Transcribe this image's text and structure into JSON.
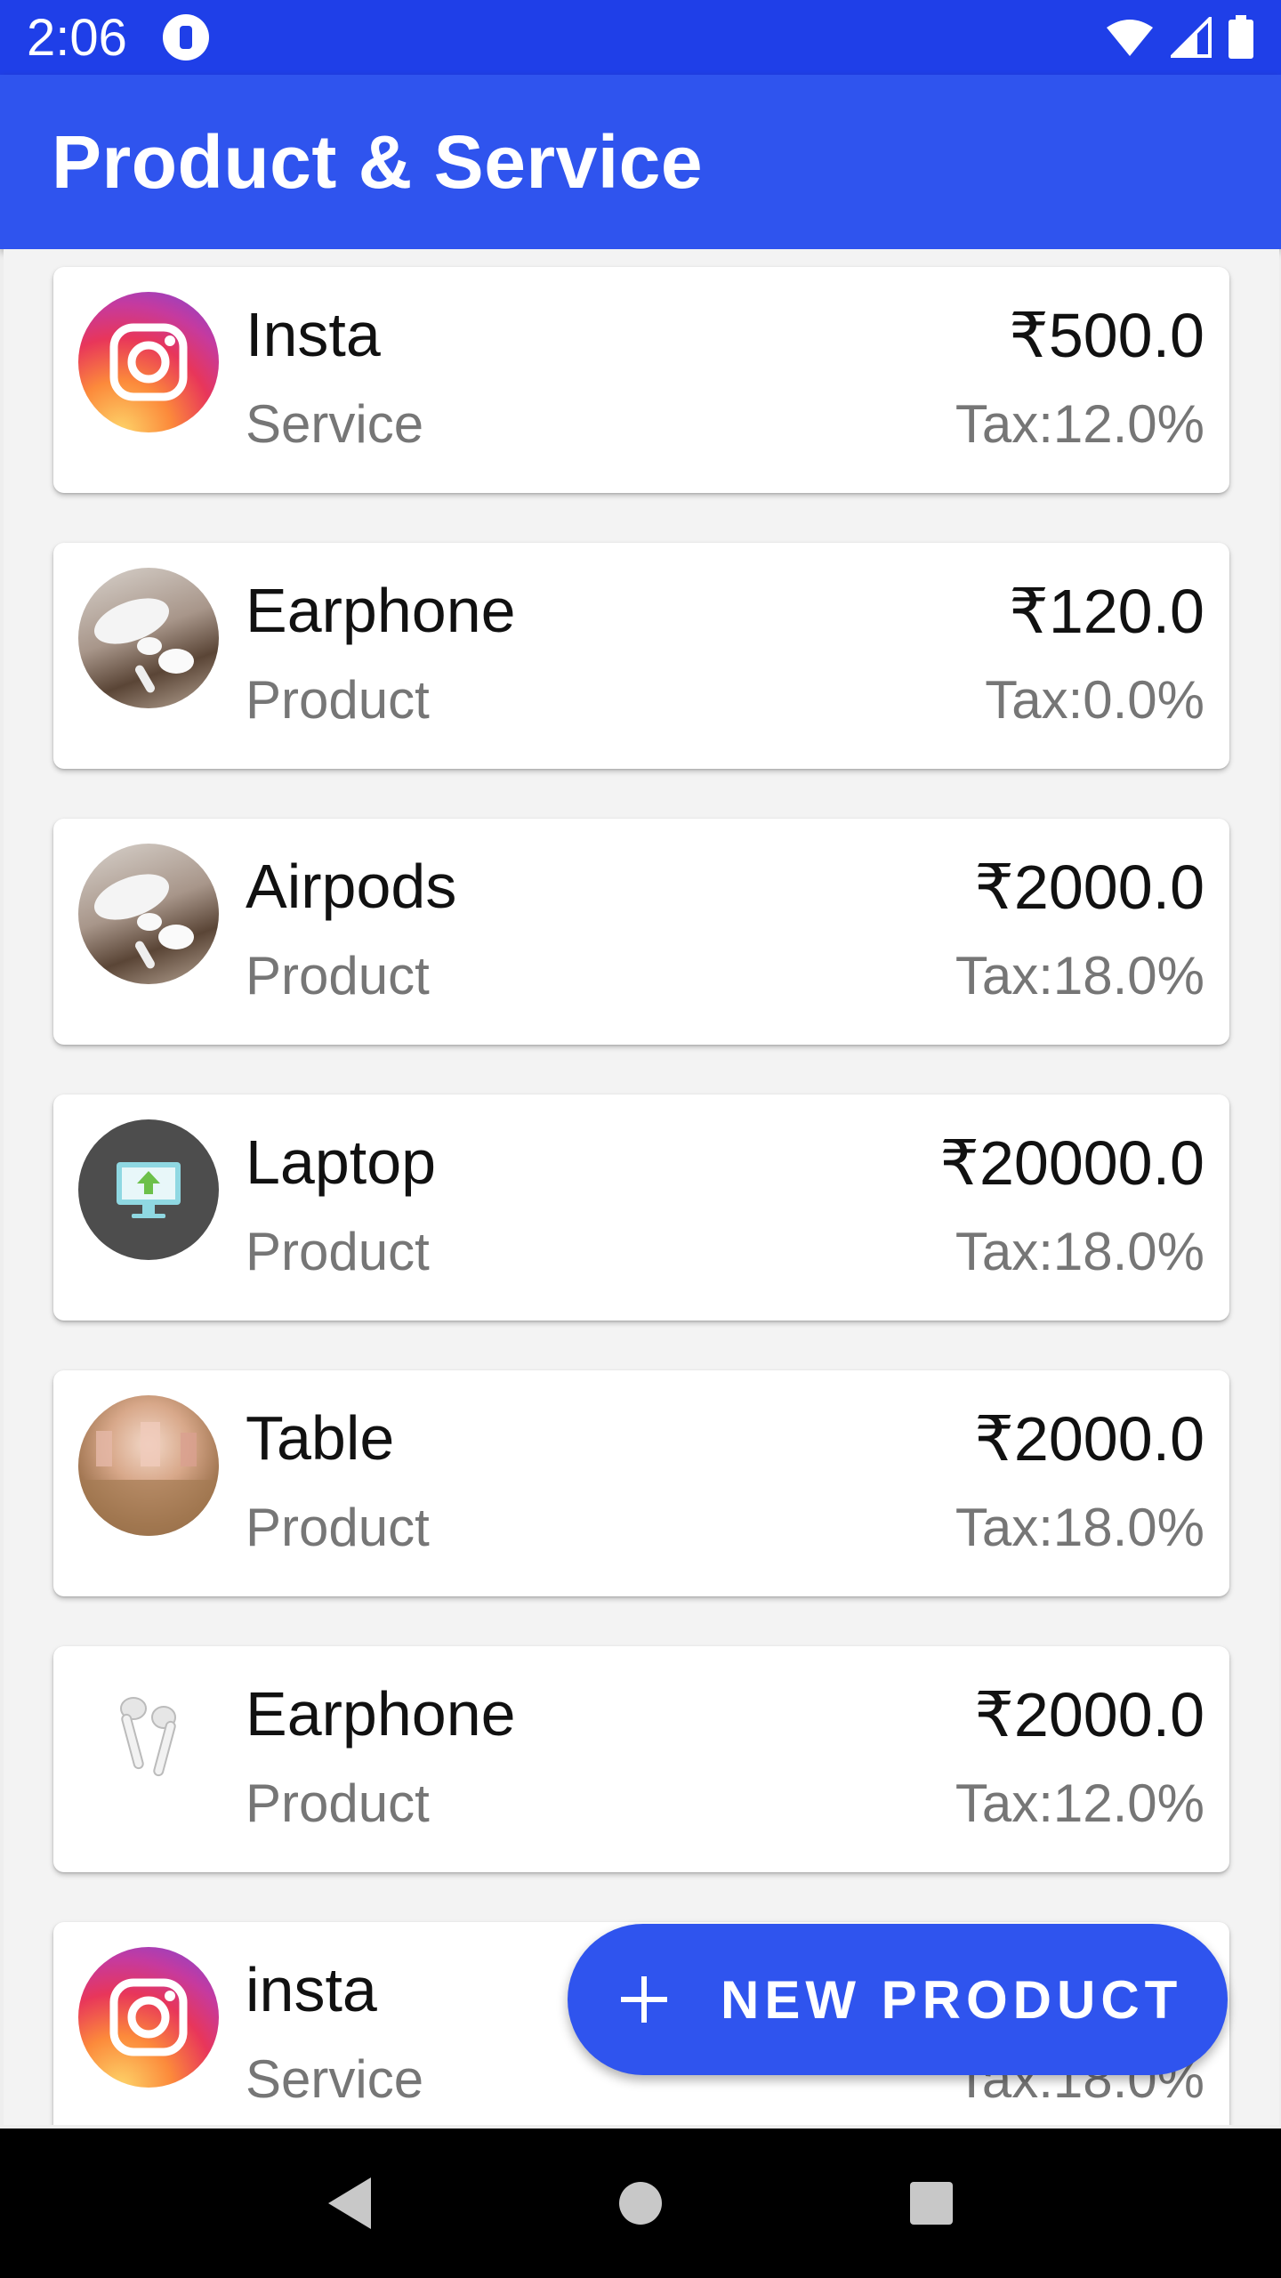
{
  "status_bar": {
    "time": "2:06"
  },
  "app_bar": {
    "title": "Product & Service"
  },
  "items": [
    {
      "name": "Insta",
      "type": "Service",
      "price": "₹500.0",
      "tax": "Tax:12.0%",
      "thumb": "instagram-logo"
    },
    {
      "name": "Earphone",
      "type": "Product",
      "price": "₹120.0",
      "tax": "Tax:0.0%",
      "thumb": "earphones-photo"
    },
    {
      "name": "Airpods",
      "type": "Product",
      "price": "₹2000.0",
      "tax": "Tax:18.0%",
      "thumb": "earphones-photo"
    },
    {
      "name": "Laptop",
      "type": "Product",
      "price": "₹20000.0",
      "tax": "Tax:18.0%",
      "thumb": "monitor-upload-icon"
    },
    {
      "name": "Table",
      "type": "Product",
      "price": "₹2000.0",
      "tax": "Tax:18.0%",
      "thumb": "store-photo"
    },
    {
      "name": "Earphone",
      "type": "Product",
      "price": "₹2000.0",
      "tax": "Tax:12.0%",
      "thumb": "airpods-photo"
    },
    {
      "name": "insta",
      "type": "Service",
      "price": "",
      "tax": "Tax:18.0%",
      "thumb": "instagram-logo"
    }
  ],
  "fab": {
    "icon": "plus-icon",
    "label": "NEW PRODUCT"
  },
  "colors": {
    "primary": "#2f54ee",
    "status_bar": "#1f3fe8"
  }
}
